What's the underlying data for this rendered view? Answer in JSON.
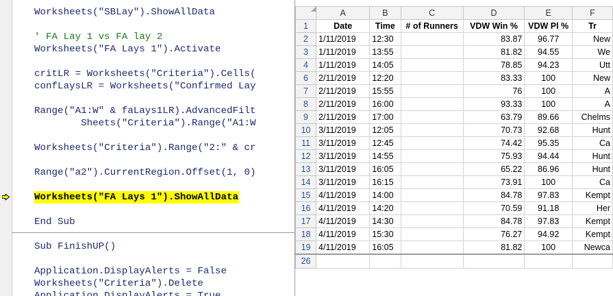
{
  "editor": {
    "lines": [
      {
        "text": "Worksheets(\"SBLay\").ShowAllData",
        "kind": "code"
      },
      {
        "text": "' FA Lay 1 vs FA lay 2",
        "kind": "comment"
      },
      {
        "text": "Worksheets(\"FA Lays 1\").Activate",
        "kind": "code"
      },
      {
        "text": "critLR = Worksheets(\"Criteria\").Cells(",
        "kind": "code"
      },
      {
        "text": "confLaysLR = Worksheets(\"Confirmed Lay",
        "kind": "code"
      },
      {
        "text": "Range(\"A1:W\" & faLays1LR).AdvancedFilt",
        "kind": "code"
      },
      {
        "text": "        Sheets(\"Criteria\").Range(\"A1:W",
        "kind": "code"
      },
      {
        "text": "Worksheets(\"Criteria\").Range(\"2:\" & cr",
        "kind": "code"
      },
      {
        "text": "Range(\"a2\").CurrentRegion.Offset(1, 0)",
        "kind": "code"
      },
      {
        "text": "Worksheets(\"FA Lays 1\").ShowAllData",
        "kind": "current"
      },
      {
        "text": "End Sub",
        "kind": "code"
      },
      {
        "text": "Sub FinishUP()",
        "kind": "code"
      },
      {
        "text": "Application.DisplayAlerts = False",
        "kind": "code"
      },
      {
        "text": "Worksheets(\"Criteria\").Delete",
        "kind": "code"
      },
      {
        "text": "Application.DisplayAlerts = True",
        "kind": "code"
      }
    ]
  },
  "sheet": {
    "columns": [
      "A",
      "B",
      "C",
      "D",
      "E",
      "F"
    ],
    "headers": [
      "Date",
      "Time",
      "# of Runners",
      "VDW Win %",
      "VDW Pl %",
      "Tr"
    ],
    "rows": [
      {
        "n": "2",
        "date": "1/11/2019",
        "time": "12:30",
        "runners": "",
        "win": "83.87",
        "pl": "96.77",
        "track": "New"
      },
      {
        "n": "3",
        "date": "1/11/2019",
        "time": "13:55",
        "runners": "",
        "win": "81.82",
        "pl": "94.55",
        "track": "We"
      },
      {
        "n": "4",
        "date": "1/11/2019",
        "time": "14:05",
        "runners": "",
        "win": "78.85",
        "pl": "94.23",
        "track": "Utt"
      },
      {
        "n": "6",
        "date": "2/11/2019",
        "time": "12:20",
        "runners": "",
        "win": "83.33",
        "pl": "100",
        "track": "New"
      },
      {
        "n": "7",
        "date": "2/11/2019",
        "time": "15:55",
        "runners": "",
        "win": "76",
        "pl": "100",
        "track": "A"
      },
      {
        "n": "8",
        "date": "2/11/2019",
        "time": "16:00",
        "runners": "",
        "win": "93.33",
        "pl": "100",
        "track": "A"
      },
      {
        "n": "9",
        "date": "2/11/2019",
        "time": "17:00",
        "runners": "",
        "win": "63.79",
        "pl": "89.66",
        "track": "Chelms"
      },
      {
        "n": "10",
        "date": "3/11/2019",
        "time": "12:05",
        "runners": "",
        "win": "70.73",
        "pl": "92.68",
        "track": "Hunt"
      },
      {
        "n": "11",
        "date": "3/11/2019",
        "time": "12:45",
        "runners": "",
        "win": "74.42",
        "pl": "95.35",
        "track": "Ca"
      },
      {
        "n": "12",
        "date": "3/11/2019",
        "time": "14:55",
        "runners": "",
        "win": "75.93",
        "pl": "94.44",
        "track": "Hunt"
      },
      {
        "n": "13",
        "date": "3/11/2019",
        "time": "16:05",
        "runners": "",
        "win": "65.22",
        "pl": "86.96",
        "track": "Hunt"
      },
      {
        "n": "14",
        "date": "3/11/2019",
        "time": "16:15",
        "runners": "",
        "win": "73.91",
        "pl": "100",
        "track": "Ca"
      },
      {
        "n": "15",
        "date": "4/11/2019",
        "time": "14:00",
        "runners": "",
        "win": "84.78",
        "pl": "97.83",
        "track": "Kempt"
      },
      {
        "n": "16",
        "date": "4/11/2019",
        "time": "14:20",
        "runners": "",
        "win": "70.59",
        "pl": "91.18",
        "track": "Her"
      },
      {
        "n": "17",
        "date": "4/11/2019",
        "time": "14:30",
        "runners": "",
        "win": "84.78",
        "pl": "97.83",
        "track": "Kempt"
      },
      {
        "n": "18",
        "date": "4/11/2019",
        "time": "15:30",
        "runners": "",
        "win": "76.27",
        "pl": "94.92",
        "track": "Kempt"
      },
      {
        "n": "19",
        "date": "4/11/2019",
        "time": "16:05",
        "runners": "",
        "win": "81.82",
        "pl": "100",
        "track": "Newca"
      }
    ],
    "last_row": "26"
  }
}
